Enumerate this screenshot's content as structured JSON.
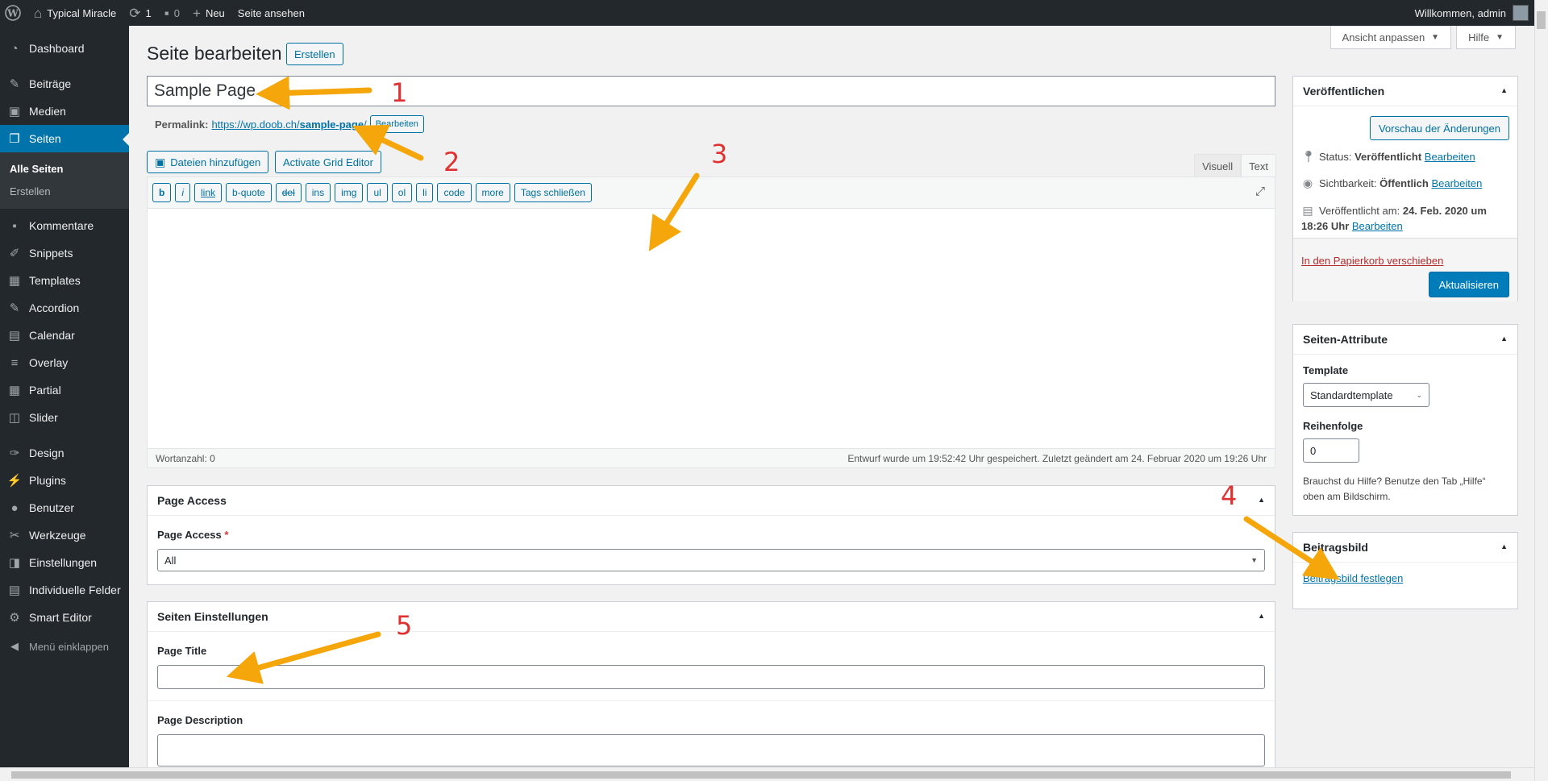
{
  "adminbar": {
    "site_name": "Typical Miracle",
    "updates_count": "1",
    "comments_count": "0",
    "new_label": "Neu",
    "view_page_label": "Seite ansehen",
    "greeting": "Willkommen, admin"
  },
  "sidebar": {
    "items": [
      {
        "label": "Dashboard"
      },
      {
        "label": "Beiträge"
      },
      {
        "label": "Medien"
      },
      {
        "label": "Seiten"
      },
      {
        "label": "Kommentare"
      },
      {
        "label": "Snippets"
      },
      {
        "label": "Templates"
      },
      {
        "label": "Accordion"
      },
      {
        "label": "Calendar"
      },
      {
        "label": "Overlay"
      },
      {
        "label": "Partial"
      },
      {
        "label": "Slider"
      },
      {
        "label": "Design"
      },
      {
        "label": "Plugins"
      },
      {
        "label": "Benutzer"
      },
      {
        "label": "Werkzeuge"
      },
      {
        "label": "Einstellungen"
      },
      {
        "label": "Individuelle Felder"
      },
      {
        "label": "Smart Editor"
      }
    ],
    "submenu": [
      "Alle Seiten",
      "Erstellen"
    ],
    "collapse_label": "Menü einklappen"
  },
  "header": {
    "title": "Seite bearbeiten",
    "add_new": "Erstellen",
    "screen_options": "Ansicht anpassen",
    "help": "Hilfe"
  },
  "post": {
    "title_value": "Sample Page",
    "permalink_label": "Permalink:",
    "permalink_url_base": "https://wp.doob.ch/",
    "permalink_slug": "sample-page",
    "permalink_url_end": "/",
    "permalink_edit": "Bearbeiten"
  },
  "editor": {
    "add_media": "Dateien hinzufügen",
    "grid_editor": "Activate Grid Editor",
    "tab_visual": "Visuell",
    "tab_text": "Text",
    "quicktags": [
      "b",
      "i",
      "link",
      "b-quote",
      "del",
      "ins",
      "img",
      "ul",
      "ol",
      "li",
      "code",
      "more",
      "Tags schließen"
    ],
    "word_count": "Wortanzahl: 0",
    "autosave_status": "Entwurf wurde um 19:52:42 Uhr gespeichert. Zuletzt geändert am 24. Februar 2020 um 19:26 Uhr"
  },
  "page_access": {
    "title": "Page Access",
    "field_label": "Page Access",
    "required_mark": "*",
    "selected": "All"
  },
  "page_settings": {
    "title": "Seiten Einstellungen",
    "page_title_label": "Page Title",
    "page_description_label": "Page Description"
  },
  "publish": {
    "title": "Veröffentlichen",
    "preview": "Vorschau der Änderungen",
    "status_label": "Status:",
    "status_value": "Veröffentlicht",
    "visibility_label": "Sichtbarkeit:",
    "visibility_value": "Öffentlich",
    "published_label": "Veröffentlicht am:",
    "published_date": "24. Feb. 2020 um",
    "published_time": "18:26 Uhr",
    "edit": "Bearbeiten",
    "trash": "In den Papierkorb verschieben",
    "update": "Aktualisieren"
  },
  "page_attributes": {
    "title": "Seiten-Attribute",
    "template_label": "Template",
    "template_value": "Standardtemplate",
    "order_label": "Reihenfolge",
    "order_value": "0",
    "help_text": "Brauchst du Hilfe? Benutze den Tab „Hilfe“ oben am Bildschirm."
  },
  "featured_image": {
    "title": "Beitragsbild",
    "set_link": "Beitragsbild festlegen"
  },
  "annotations": {
    "numbers": [
      "1",
      "2",
      "3",
      "4",
      "5"
    ],
    "arrow_color": "#f5a60a",
    "number_color": "#e03131"
  },
  "colors": {
    "accent": "#0073aa",
    "adminbar_bg": "#23282d",
    "page_bg": "#f1f1f1"
  }
}
